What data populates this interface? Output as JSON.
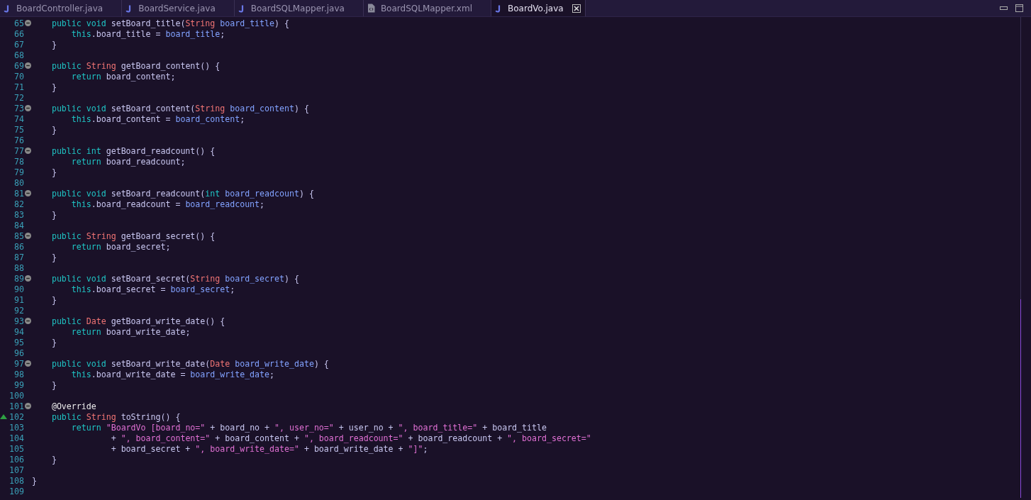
{
  "tabs": [
    {
      "label": "BoardController.java",
      "kind": "java",
      "selected": false
    },
    {
      "label": "BoardService.java",
      "kind": "java",
      "selected": false
    },
    {
      "label": "BoardSQLMapper.java",
      "kind": "java",
      "selected": false
    },
    {
      "label": "BoardSQLMapper.xml",
      "kind": "xml",
      "selected": false
    },
    {
      "label": "BoardVo.java",
      "kind": "java",
      "selected": true
    }
  ],
  "lines": [
    {
      "number": "65",
      "collapsible": true,
      "kind": "member",
      "tokens": [
        {
          "kind": "keyword",
          "text": "public void "
        },
        {
          "kind": "plain",
          "text": "setBoard_title("
        },
        {
          "kind": "type",
          "text": "String "
        },
        {
          "kind": "field",
          "text": "board_title"
        },
        {
          "kind": "plain",
          "text": ") {"
        }
      ]
    },
    {
      "number": "66",
      "kind": "statement",
      "tokens": [
        {
          "kind": "keyword",
          "text": "this"
        },
        {
          "kind": "plain",
          "text": ".board_title = "
        },
        {
          "kind": "field",
          "text": "board_title"
        },
        {
          "kind": "plain",
          "text": ";"
        }
      ]
    },
    {
      "number": "67",
      "kind": "member",
      "tokens": [
        {
          "kind": "plain",
          "text": "}"
        }
      ]
    },
    {
      "number": "68"
    },
    {
      "number": "69",
      "collapsible": true,
      "kind": "member",
      "tokens": [
        {
          "kind": "keyword",
          "text": "public "
        },
        {
          "kind": "type",
          "text": "String"
        },
        {
          "kind": "plain",
          "text": " getBoard_content() {"
        }
      ]
    },
    {
      "number": "70",
      "kind": "statement",
      "tokens": [
        {
          "kind": "keyword",
          "text": "return "
        },
        {
          "kind": "plain",
          "text": "board_content;"
        }
      ]
    },
    {
      "number": "71",
      "kind": "member",
      "tokens": [
        {
          "kind": "plain",
          "text": "}"
        }
      ]
    },
    {
      "number": "72"
    },
    {
      "number": "73",
      "collapsible": true,
      "kind": "member",
      "tokens": [
        {
          "kind": "keyword",
          "text": "public void "
        },
        {
          "kind": "plain",
          "text": "setBoard_content("
        },
        {
          "kind": "type",
          "text": "String "
        },
        {
          "kind": "field",
          "text": "board_content"
        },
        {
          "kind": "plain",
          "text": ") {"
        }
      ]
    },
    {
      "number": "74",
      "kind": "statement",
      "tokens": [
        {
          "kind": "keyword",
          "text": "this"
        },
        {
          "kind": "plain",
          "text": ".board_content = "
        },
        {
          "kind": "field",
          "text": "board_content"
        },
        {
          "kind": "plain",
          "text": ";"
        }
      ]
    },
    {
      "number": "75",
      "kind": "member",
      "tokens": [
        {
          "kind": "plain",
          "text": "}"
        }
      ]
    },
    {
      "number": "76"
    },
    {
      "number": "77",
      "collapsible": true,
      "kind": "member",
      "tokens": [
        {
          "kind": "keyword",
          "text": "public int "
        },
        {
          "kind": "plain",
          "text": "getBoard_readcount() {"
        }
      ]
    },
    {
      "number": "78",
      "kind": "statement",
      "tokens": [
        {
          "kind": "keyword",
          "text": "return "
        },
        {
          "kind": "plain",
          "text": "board_readcount;"
        }
      ]
    },
    {
      "number": "79",
      "kind": "member",
      "tokens": [
        {
          "kind": "plain",
          "text": "}"
        }
      ]
    },
    {
      "number": "80"
    },
    {
      "number": "81",
      "collapsible": true,
      "kind": "member",
      "tokens": [
        {
          "kind": "keyword",
          "text": "public void "
        },
        {
          "kind": "plain",
          "text": "setBoard_readcount("
        },
        {
          "kind": "keyword",
          "text": "int "
        },
        {
          "kind": "field",
          "text": "board_readcount"
        },
        {
          "kind": "plain",
          "text": ") {"
        }
      ]
    },
    {
      "number": "82",
      "kind": "statement",
      "tokens": [
        {
          "kind": "keyword",
          "text": "this"
        },
        {
          "kind": "plain",
          "text": ".board_readcount = "
        },
        {
          "kind": "field",
          "text": "board_readcount"
        },
        {
          "kind": "plain",
          "text": ";"
        }
      ]
    },
    {
      "number": "83",
      "kind": "member",
      "tokens": [
        {
          "kind": "plain",
          "text": "}"
        }
      ]
    },
    {
      "number": "84"
    },
    {
      "number": "85",
      "collapsible": true,
      "kind": "member",
      "tokens": [
        {
          "kind": "keyword",
          "text": "public "
        },
        {
          "kind": "type",
          "text": "String"
        },
        {
          "kind": "plain",
          "text": " getBoard_secret() {"
        }
      ]
    },
    {
      "number": "86",
      "kind": "statement",
      "tokens": [
        {
          "kind": "keyword",
          "text": "return "
        },
        {
          "kind": "plain",
          "text": "board_secret;"
        }
      ]
    },
    {
      "number": "87",
      "kind": "member",
      "tokens": [
        {
          "kind": "plain",
          "text": "}"
        }
      ]
    },
    {
      "number": "88"
    },
    {
      "number": "89",
      "collapsible": true,
      "kind": "member",
      "tokens": [
        {
          "kind": "keyword",
          "text": "public void "
        },
        {
          "kind": "plain",
          "text": "setBoard_secret("
        },
        {
          "kind": "type",
          "text": "String "
        },
        {
          "kind": "field",
          "text": "board_secret"
        },
        {
          "kind": "plain",
          "text": ") {"
        }
      ]
    },
    {
      "number": "90",
      "kind": "statement",
      "tokens": [
        {
          "kind": "keyword",
          "text": "this"
        },
        {
          "kind": "plain",
          "text": ".board_secret = "
        },
        {
          "kind": "field",
          "text": "board_secret"
        },
        {
          "kind": "plain",
          "text": ";"
        }
      ]
    },
    {
      "number": "91",
      "kind": "member",
      "tokens": [
        {
          "kind": "plain",
          "text": "}"
        }
      ]
    },
    {
      "number": "92"
    },
    {
      "number": "93",
      "collapsible": true,
      "kind": "member",
      "tokens": [
        {
          "kind": "keyword",
          "text": "public "
        },
        {
          "kind": "type",
          "text": "Date"
        },
        {
          "kind": "plain",
          "text": " getBoard_write_date() {"
        }
      ]
    },
    {
      "number": "94",
      "kind": "statement",
      "tokens": [
        {
          "kind": "keyword",
          "text": "return "
        },
        {
          "kind": "plain",
          "text": "board_write_date;"
        }
      ]
    },
    {
      "number": "95",
      "kind": "member",
      "tokens": [
        {
          "kind": "plain",
          "text": "}"
        }
      ]
    },
    {
      "number": "96"
    },
    {
      "number": "97",
      "collapsible": true,
      "kind": "member",
      "tokens": [
        {
          "kind": "keyword",
          "text": "public void "
        },
        {
          "kind": "plain",
          "text": "setBoard_write_date("
        },
        {
          "kind": "type",
          "text": "Date "
        },
        {
          "kind": "field",
          "text": "board_write_date"
        },
        {
          "kind": "plain",
          "text": ") {"
        }
      ]
    },
    {
      "number": "98",
      "kind": "statement",
      "tokens": [
        {
          "kind": "keyword",
          "text": "this"
        },
        {
          "kind": "plain",
          "text": ".board_write_date = "
        },
        {
          "kind": "field",
          "text": "board_write_date"
        },
        {
          "kind": "plain",
          "text": ";"
        }
      ]
    },
    {
      "number": "99",
      "kind": "member",
      "tokens": [
        {
          "kind": "plain",
          "text": "}"
        }
      ]
    },
    {
      "number": "100"
    },
    {
      "number": "101",
      "collapsible": true,
      "kind": "member",
      "tokens": [
        {
          "kind": "annotation",
          "text": "@Override"
        }
      ]
    },
    {
      "number": "102",
      "overrides": true,
      "kind": "member",
      "tokens": [
        {
          "kind": "keyword",
          "text": "public "
        },
        {
          "kind": "type",
          "text": "String"
        },
        {
          "kind": "plain",
          "text": " toString() {"
        }
      ]
    },
    {
      "number": "103",
      "kind": "statement",
      "tokens": [
        {
          "kind": "keyword",
          "text": "return "
        },
        {
          "kind": "string",
          "text": "\"BoardVo [board_no=\""
        },
        {
          "kind": "plain",
          "text": " + board_no + "
        },
        {
          "kind": "string",
          "text": "\", user_no=\""
        },
        {
          "kind": "plain",
          "text": " + user_no + "
        },
        {
          "kind": "string",
          "text": "\", board_title=\""
        },
        {
          "kind": "plain",
          "text": " + board_title"
        }
      ]
    },
    {
      "number": "104",
      "kind": "continuation",
      "tokens": [
        {
          "kind": "plain",
          "text": "+ "
        },
        {
          "kind": "string",
          "text": "\", board_content=\""
        },
        {
          "kind": "plain",
          "text": " + board_content + "
        },
        {
          "kind": "string",
          "text": "\", board_readcount=\""
        },
        {
          "kind": "plain",
          "text": " + board_readcount + "
        },
        {
          "kind": "string",
          "text": "\", board_secret=\""
        }
      ]
    },
    {
      "number": "105",
      "kind": "continuation",
      "tokens": [
        {
          "kind": "plain",
          "text": "+ board_secret + "
        },
        {
          "kind": "string",
          "text": "\", board_write_date=\""
        },
        {
          "kind": "plain",
          "text": " + board_write_date + "
        },
        {
          "kind": "string",
          "text": "\"]\""
        },
        {
          "kind": "plain",
          "text": ";"
        }
      ]
    },
    {
      "number": "106",
      "kind": "member",
      "tokens": [
        {
          "kind": "plain",
          "text": "}"
        }
      ]
    },
    {
      "number": "107"
    },
    {
      "number": "108",
      "kind": "class",
      "tokens": [
        {
          "kind": "plain",
          "text": "}"
        }
      ]
    },
    {
      "number": "109"
    }
  ]
}
